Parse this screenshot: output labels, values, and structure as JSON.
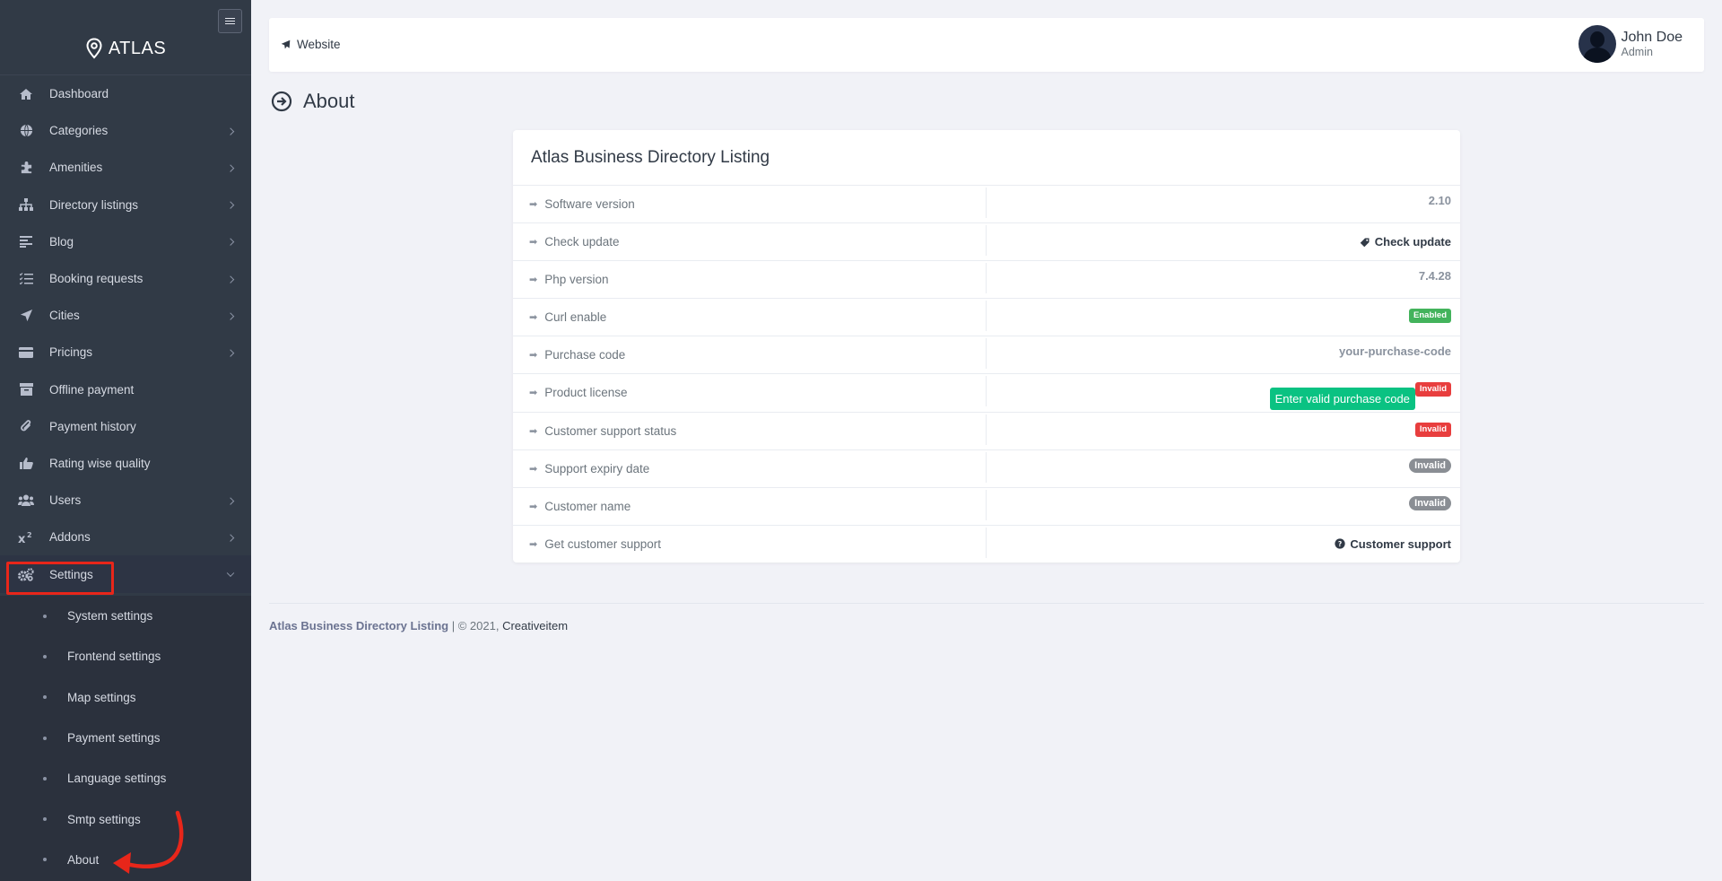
{
  "app": {
    "logo_text": "ATLAS"
  },
  "sidebar": {
    "items": [
      {
        "label": "Dashboard",
        "icon": "home-icon",
        "has_chevron": false
      },
      {
        "label": "Categories",
        "icon": "globe-icon",
        "has_chevron": true
      },
      {
        "label": "Amenities",
        "icon": "puzzle-icon",
        "has_chevron": true
      },
      {
        "label": "Directory listings",
        "icon": "sitemap-icon",
        "has_chevron": true
      },
      {
        "label": "Blog",
        "icon": "align-left-icon",
        "has_chevron": true
      },
      {
        "label": "Booking requests",
        "icon": "tasks-icon",
        "has_chevron": true
      },
      {
        "label": "Cities",
        "icon": "location-arrow-icon",
        "has_chevron": true
      },
      {
        "label": "Pricings",
        "icon": "credit-card-icon",
        "has_chevron": true
      },
      {
        "label": "Offline payment",
        "icon": "archive-icon",
        "has_chevron": false
      },
      {
        "label": "Payment history",
        "icon": "paperclip-icon",
        "has_chevron": false
      },
      {
        "label": "Rating wise quality",
        "icon": "thumbs-up-icon",
        "has_chevron": false
      },
      {
        "label": "Users",
        "icon": "users-icon",
        "has_chevron": true
      },
      {
        "label": "Addons",
        "icon": "superscript-icon",
        "has_chevron": true
      },
      {
        "label": "Settings",
        "icon": "cogs-icon",
        "has_chevron": true
      }
    ],
    "settings_submenu": [
      "System settings",
      "Frontend settings",
      "Map settings",
      "Payment settings",
      "Language settings",
      "Smtp settings",
      "About"
    ]
  },
  "topbar": {
    "website_label": "Website",
    "user_name": "John Doe",
    "user_role": "Admin"
  },
  "page": {
    "title": "About"
  },
  "card": {
    "title": "Atlas Business Directory Listing",
    "rows": [
      {
        "label": "Software version",
        "value": "2.10"
      },
      {
        "label": "Check update",
        "value": "Check update"
      },
      {
        "label": "Php version",
        "value": "7.4.28"
      },
      {
        "label": "Curl enable",
        "value": "Enabled"
      },
      {
        "label": "Purchase code",
        "value": "your-purchase-code"
      },
      {
        "label": "Product license",
        "button": "Enter valid purchase code",
        "value": "Invalid"
      },
      {
        "label": "Customer support status",
        "value": "Invalid"
      },
      {
        "label": "Support expiry date",
        "value": "Invalid"
      },
      {
        "label": "Customer name",
        "value": "Invalid"
      },
      {
        "label": "Get customer support",
        "value": "Customer support"
      }
    ]
  },
  "footer": {
    "brand": "Atlas Business Directory Listing",
    "copyright": " | © 2021, ",
    "company": "Creativeitem"
  },
  "colors": {
    "sidebar_bg": "#313a46",
    "accent_green": "#0ac282",
    "badge_red": "#e83e3e",
    "badge_green": "#43b35c",
    "annotation_red": "#e8261a"
  }
}
